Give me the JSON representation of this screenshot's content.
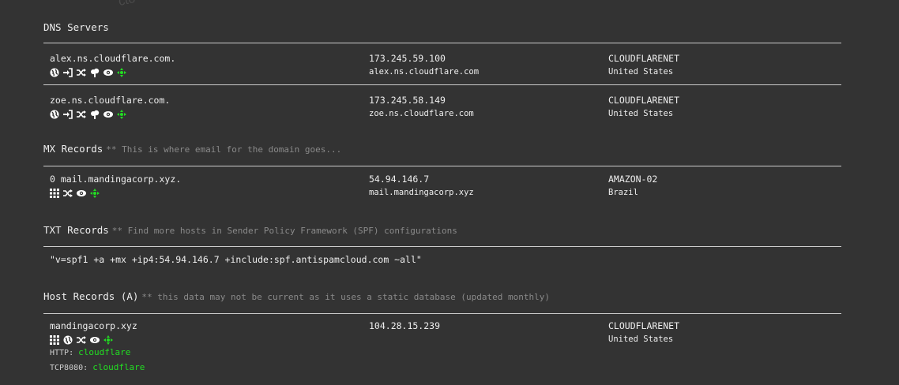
{
  "watermark": "cto",
  "dns": {
    "title": "DNS Servers",
    "rows": [
      {
        "name": "alex.ns.cloudflare.com.",
        "ip": "173.245.59.100",
        "host": "alex.ns.cloudflare.com",
        "asn": "CLOUDFLARENET",
        "country": "United States"
      },
      {
        "name": "zoe.ns.cloudflare.com.",
        "ip": "173.245.58.149",
        "host": "zoe.ns.cloudflare.com",
        "asn": "CLOUDFLARENET",
        "country": "United States"
      }
    ]
  },
  "mx": {
    "title": "MX Records",
    "note": "** This is where email for the domain goes...",
    "rows": [
      {
        "name": "0 mail.mandingacorp.xyz.",
        "ip": "54.94.146.7",
        "host": "mail.mandingacorp.xyz",
        "asn": "AMAZON-02",
        "country": "Brazil"
      }
    ]
  },
  "txt": {
    "title": "TXT Records",
    "note": "** Find more hosts in Sender Policy Framework (SPF) configurations",
    "value": "\"v=spf1 +a +mx +ip4:54.94.146.7 +include:spf.antispamcloud.com ~all\""
  },
  "host": {
    "title": "Host Records (A)",
    "note": "** this data may not be current as it uses a static database (updated monthly)",
    "rows": [
      {
        "name": "mandingacorp.xyz",
        "ip": "104.28.15.239",
        "asn": "CLOUDFLARENET",
        "country": "United States",
        "http_label": "HTTP:",
        "http_value": "cloudflare",
        "tcp_label": "TCP8080:",
        "tcp_value": "cloudflare"
      }
    ]
  },
  "colors": {
    "background": "#333333",
    "accent_green": "#22dd22",
    "text": "#eeeeee",
    "muted": "#8a8a8a"
  }
}
